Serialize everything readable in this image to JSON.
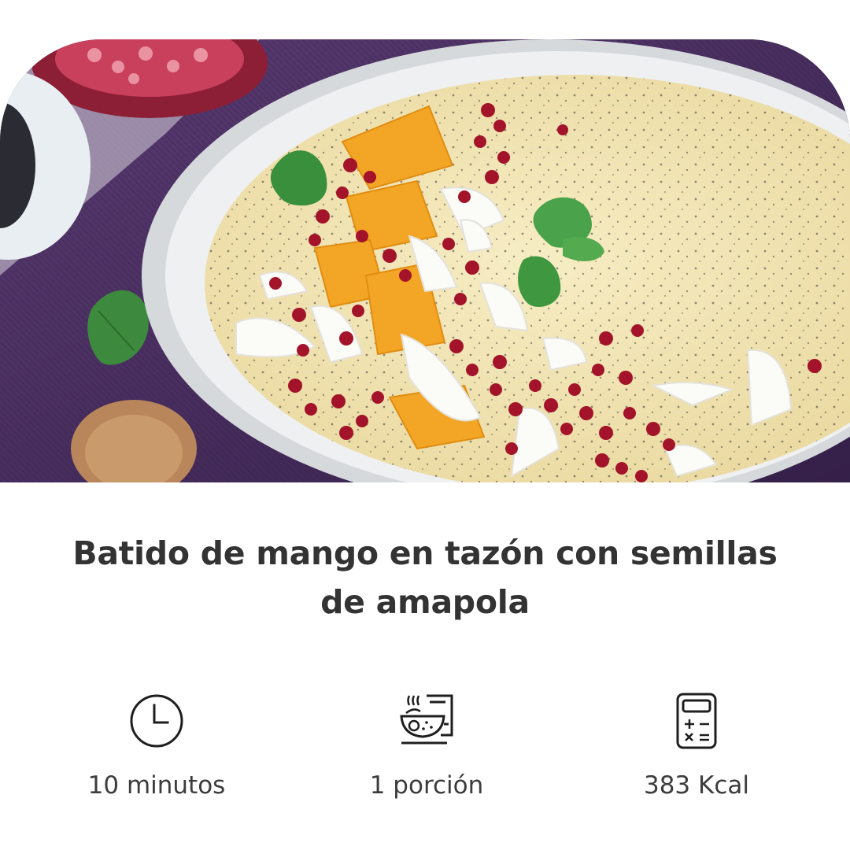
{
  "recipe": {
    "title": "Batido de mango en tazón con semillas de amapola"
  },
  "stats": {
    "time": {
      "label": "10 minutos",
      "icon": "clock-icon"
    },
    "serving": {
      "label": "1 porción",
      "icon": "bowl-serving-icon"
    },
    "calories": {
      "label": "383 Kcal",
      "icon": "calculator-icon"
    }
  },
  "colors": {
    "text": "#333333",
    "background": "#ffffff",
    "placemat": "#4a2f5e",
    "smoothie": "#f1e4b4",
    "mango": "#f3a526",
    "pomegranate": "#a3132a"
  }
}
